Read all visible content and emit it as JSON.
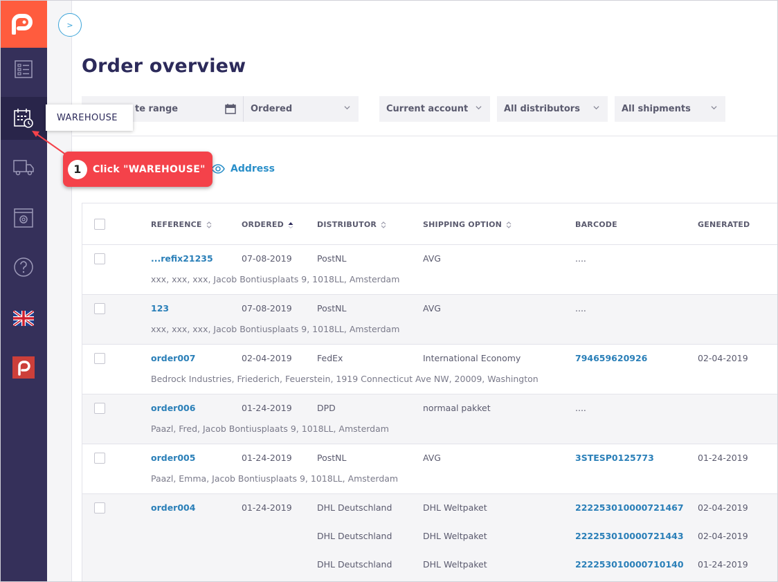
{
  "sidebar": {
    "items": [
      {
        "name": "orders",
        "icon": "list-icon"
      },
      {
        "name": "warehouse",
        "icon": "warehouse-calendar-icon",
        "active": true
      },
      {
        "name": "shipping",
        "icon": "truck-icon"
      },
      {
        "name": "settings",
        "icon": "settings-window-icon"
      },
      {
        "name": "help",
        "icon": "help-icon"
      },
      {
        "name": "language",
        "icon": "uk-flag-icon"
      },
      {
        "name": "brand",
        "icon": "paazl-logo-icon"
      }
    ],
    "tooltip": "WAREHOUSE"
  },
  "expand_label": ">",
  "page": {
    "title": "Order overview"
  },
  "filters": {
    "date_range": "te range",
    "status": "Ordered",
    "account": "Current account",
    "distributors": "All distributors",
    "shipments": "All shipments"
  },
  "address_toggle": "Address",
  "callout": {
    "number": "1",
    "text": "Click \"WAREHOUSE\""
  },
  "table": {
    "headers": {
      "reference": "REFERENCE",
      "ordered": "ORDERED",
      "distributor": "DISTRIBUTOR",
      "shipping_option": "SHIPPING OPTION",
      "barcode": "BARCODE",
      "generated": "GENERATED"
    },
    "rows": [
      {
        "reference": "...refix21235",
        "ordered": "07-08-2019",
        "distributor": "PostNL",
        "shipping": "AVG",
        "barcode": "....",
        "generated": "",
        "address": "xxx, xxx, xxx, Jacob Bontiusplaats 9, 1018LL, Amsterdam"
      },
      {
        "reference": "123",
        "ordered": "07-08-2019",
        "distributor": "PostNL",
        "shipping": "AVG",
        "barcode": "....",
        "generated": "",
        "address": "xxx, xxx, xxx, Jacob Bontiusplaats 9, 1018LL, Amsterdam"
      },
      {
        "reference": "order007",
        "ordered": "02-04-2019",
        "distributor": "FedEx",
        "shipping": "International Economy",
        "barcode": "794659620926",
        "generated": "02-04-2019",
        "address": "Bedrock Industries, Friederich, Feuerstein, 1919 Connecticut Ave NW, 20009, Washington"
      },
      {
        "reference": "order006",
        "ordered": "01-24-2019",
        "distributor": "DPD",
        "shipping": "normaal pakket",
        "barcode": "....",
        "generated": "",
        "address": "Paazl, Fred, Jacob Bontiusplaats 9, 1018LL, Amsterdam"
      },
      {
        "reference": "order005",
        "ordered": "01-24-2019",
        "distributor": "PostNL",
        "shipping": "AVG",
        "barcode": "3STESP0125773",
        "generated": "01-24-2019",
        "address": "Paazl, Emma, Jacob Bontiusplaats 9, 1018LL, Amsterdam"
      },
      {
        "reference": "order004",
        "ordered": "01-24-2019",
        "distributor": "DHL Deutschland",
        "shipping": "DHL Weltpaket",
        "barcode": "222253010000721467",
        "generated": "02-04-2019",
        "address": ""
      }
    ],
    "subrows": [
      {
        "distributor": "DHL Deutschland",
        "shipping": "DHL Weltpaket",
        "barcode": "222253010000721443",
        "generated": "02-04-2019"
      },
      {
        "distributor": "DHL Deutschland",
        "shipping": "DHL Weltpaket",
        "barcode": "222253010000710140",
        "generated": "01-24-2019"
      }
    ]
  },
  "colors": {
    "brand": "#ff5c3e",
    "sidebar": "#35305a",
    "link": "#2a7fb8",
    "callout": "#f4424a"
  }
}
